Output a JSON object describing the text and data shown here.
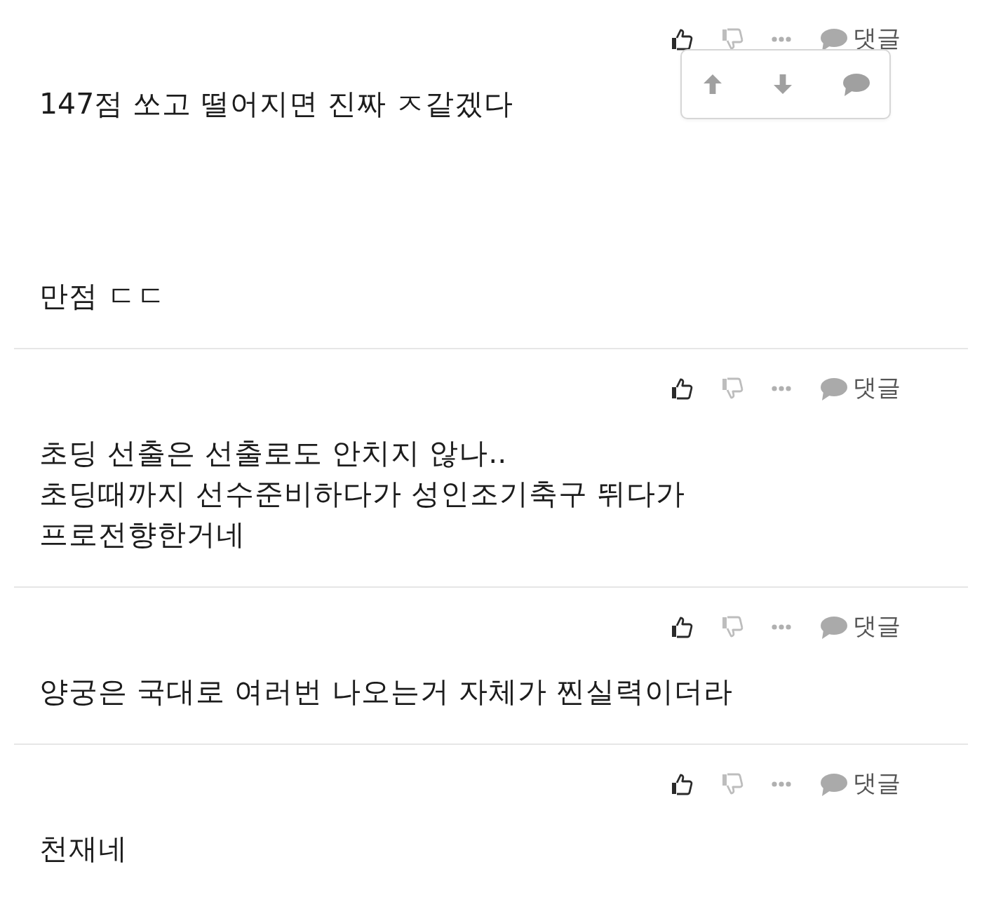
{
  "comments": [
    {
      "texts": [
        "147점 쏘고 떨어지면 진짜 ㅈ같겠다",
        "만점 ㄷㄷ"
      ],
      "reply_label": "댓글",
      "menu_open": true
    },
    {
      "texts": [
        "초딩 선출은 선출로도 안치지 않나..\n초딩때까지 선수준비하다가 성인조기축구 뛰다가\n프로전향한거네"
      ],
      "reply_label": "댓글",
      "menu_open": false
    },
    {
      "texts": [
        "양궁은 국대로 여러번 나오는거 자체가 찐실력이더라"
      ],
      "reply_label": "댓글",
      "menu_open": false
    },
    {
      "texts": [
        "천재네"
      ],
      "reply_label": "댓글",
      "menu_open": false
    }
  ]
}
